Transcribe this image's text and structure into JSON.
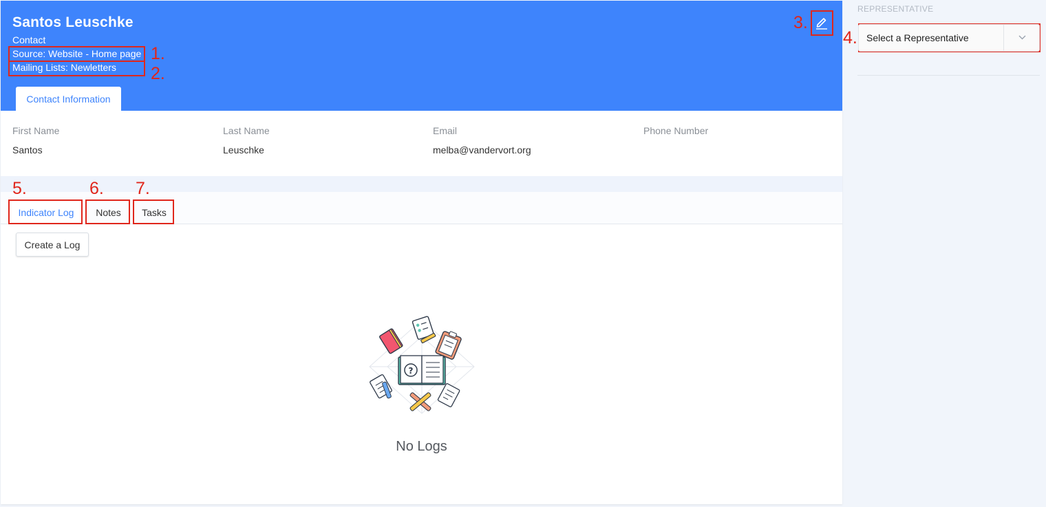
{
  "header": {
    "name": "Santos Leuschke",
    "type": "Contact",
    "source": "Source: Website - Home page",
    "mailing_lists": "Mailing Lists: Newletters",
    "bg_color": "#3e84fc"
  },
  "tabs": {
    "contact_information": "Contact Information"
  },
  "fields": [
    {
      "label": "First Name",
      "value": "Santos"
    },
    {
      "label": "Last Name",
      "value": "Leuschke"
    },
    {
      "label": "Email",
      "value": "melba@vandervort.org"
    },
    {
      "label": "Phone Number",
      "value": ""
    }
  ],
  "activity_tabs": [
    {
      "label": "Indicator Log",
      "active": true
    },
    {
      "label": "Notes",
      "active": false
    },
    {
      "label": "Tasks",
      "active": false
    }
  ],
  "create_log_label": "Create a Log",
  "empty_state": {
    "text": "No Logs",
    "icon": "empty-logs-illustration"
  },
  "sidebar": {
    "representative_label": "REPRESENTATIVE",
    "representative_select": "Select a Representative"
  },
  "annotations": [
    "1.",
    "2.",
    "3.",
    "4.",
    "5.",
    "6.",
    "7."
  ],
  "colors": {
    "accent": "#3e84fc",
    "annotation": "#e0261b"
  },
  "icons": {
    "edit": "pencil-icon",
    "dropdown": "chevron-down-icon"
  }
}
